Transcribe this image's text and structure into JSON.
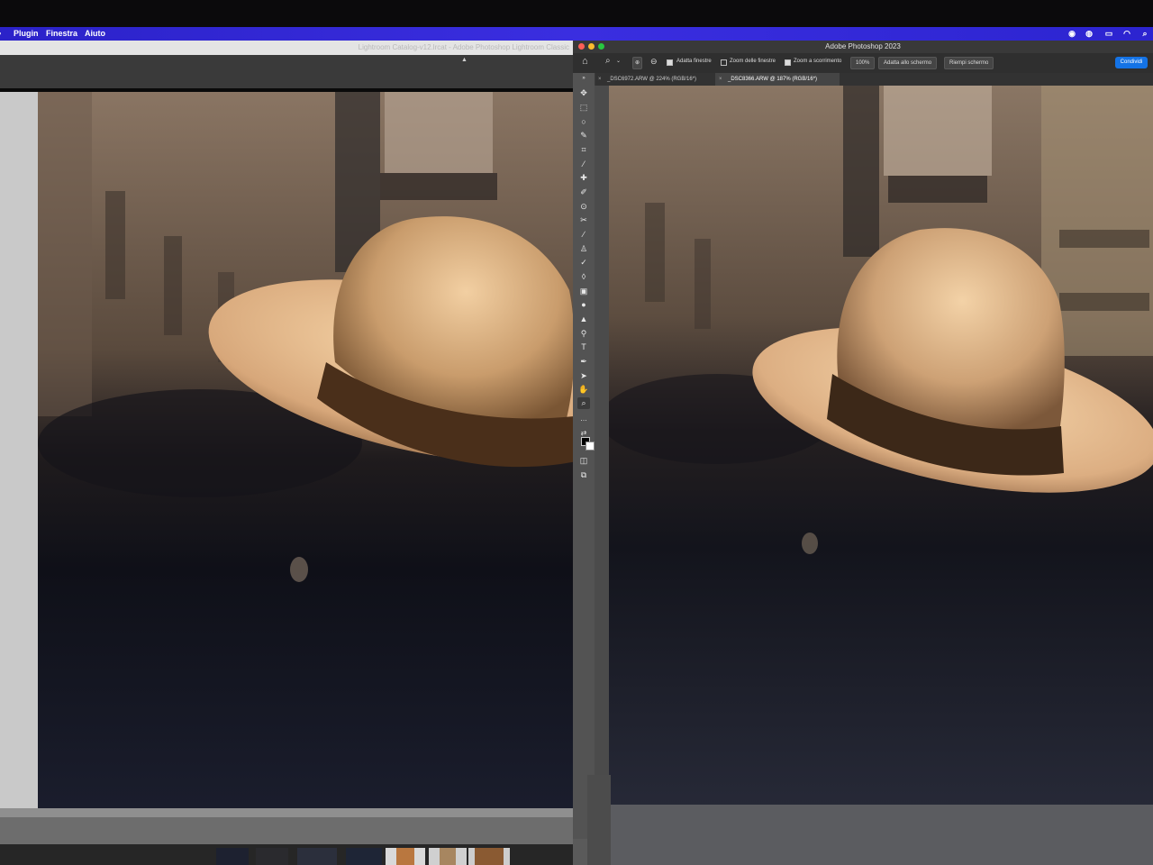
{
  "menubar": {
    "items": [
      "Plugin",
      "Finestra",
      "Aiuto"
    ]
  },
  "lightroom": {
    "window_title": "Lightroom Catalog-v12.lrcat - Adobe Photoshop Lightroom Classic"
  },
  "photoshop": {
    "window_title": "Adobe Photoshop 2023",
    "options": {
      "fit_windows": {
        "label": "Adatta finestre",
        "checked": true
      },
      "zoom_all_windows": {
        "label": "Zoom delle finestre",
        "checked": false
      },
      "scrubby_zoom": {
        "label": "Zoom a scorrimento",
        "checked": true
      },
      "zoom_100": "100%",
      "fit_screen": "Adatta allo schermo",
      "fill_screen": "Riempi schermo",
      "share": "Condividi"
    },
    "tabs": [
      {
        "label": "_DSC6972.ARW @ 224% (RGB/16*)",
        "active": false
      },
      {
        "label": "_DSC8366.ARW @ 187% (RGB/16*)",
        "active": true
      }
    ],
    "tools": [
      "move-tool",
      "marquee-tool",
      "lasso-tool",
      "quick-select-tool",
      "crop-tool",
      "eyedropper-tool",
      "healing-tool",
      "brush-tool",
      "stamp-tool",
      "history-brush-tool",
      "eraser-tool",
      "gradient-tool",
      "blur-tool",
      "dodge-tool",
      "pen-tool",
      "type-tool",
      "path-select-tool",
      "shape-tool",
      "hand-tool",
      "zoom-tool",
      "more-tools",
      "color-swatches",
      "quick-mask",
      "screen-mode"
    ]
  },
  "colors": {
    "menubar": "#3a2ee0",
    "share_button": "#1473e6"
  }
}
